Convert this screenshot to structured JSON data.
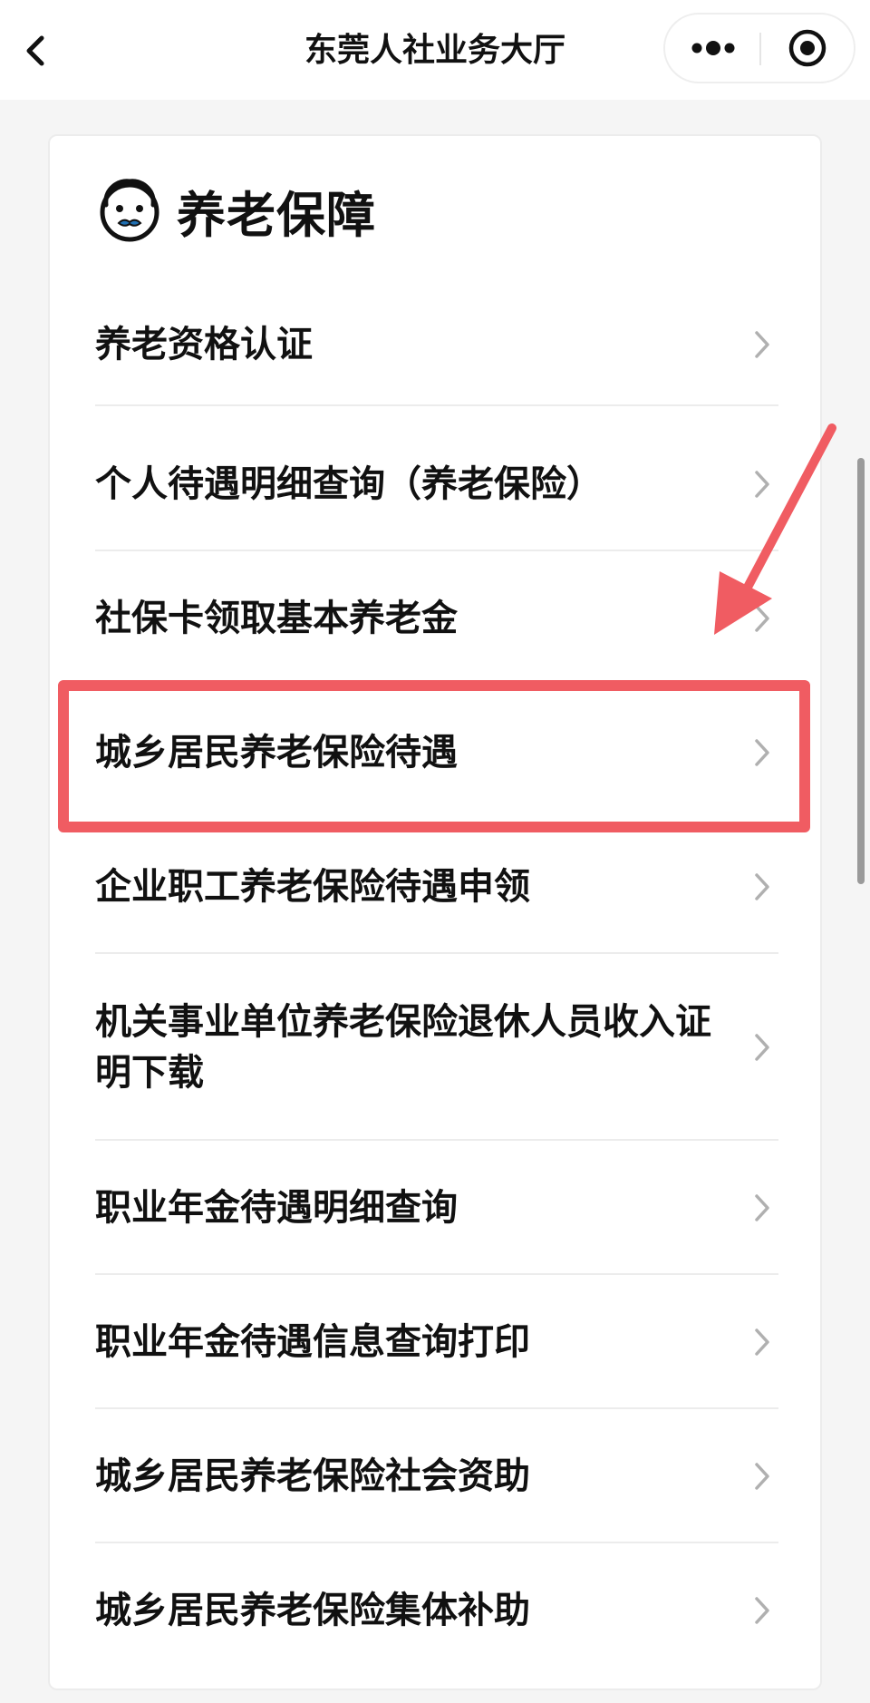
{
  "navbar": {
    "title": "东莞人社业务大厅",
    "back_icon": "chevron-left-icon",
    "more_icon": "more-dots-icon",
    "close_icon": "target-circle-icon"
  },
  "section": {
    "title": "养老保障",
    "icon": "elderly-face-icon"
  },
  "items": [
    {
      "label": "养老资格认证"
    },
    {
      "label": "个人待遇明细查询（养老保险）"
    },
    {
      "label": "社保卡领取基本养老金"
    },
    {
      "label": "城乡居民养老保险待遇"
    },
    {
      "label": "企业职工养老保险待遇申领"
    },
    {
      "label": "机关事业单位养老保险退休人员收入证明下载"
    },
    {
      "label": "职业年金待遇明细查询"
    },
    {
      "label": "职业年金待遇信息查询打印"
    },
    {
      "label": "城乡居民养老保险社会资助"
    },
    {
      "label": "城乡居民养老保险集体补助"
    }
  ],
  "colors": {
    "highlight": "#f05c62",
    "chevron": "#b0b0b0",
    "background": "#f5f5f5"
  }
}
